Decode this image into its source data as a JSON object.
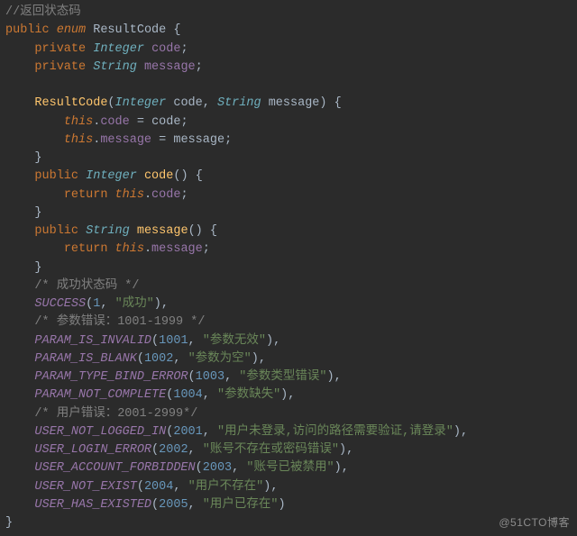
{
  "watermark": "@51CTO博客",
  "code": {
    "comment_top": "//返回状态码",
    "kw_public": "public",
    "kw_enum": "enum",
    "class_name": "ResultCode",
    "brace_open": "{",
    "kw_private": "private",
    "type_integer": "Integer",
    "type_string": "String",
    "field_code": "code",
    "field_message": "message",
    "semicolon": ";",
    "ctor_name": "ResultCode",
    "paren_open": "(",
    "paren_close": ")",
    "comma": ",",
    "space": " ",
    "kw_this": "this",
    "dot": ".",
    "eq": "=",
    "brace_close": "}",
    "method_code": "code",
    "method_message": "message",
    "kw_return": "return",
    "cmt_success": "/* 成功状态码 */",
    "enum_success": "SUCCESS",
    "num_1": "1",
    "str_success": "\"成功\"",
    "cmt_param": "/* 参数错误：1001-1999 */",
    "enum_pinv": "PARAM_IS_INVALID",
    "num_1001": "1001",
    "str_pinv": "\"参数无效\"",
    "enum_pblank": "PARAM_IS_BLANK",
    "num_1002": "1002",
    "str_pblank": "\"参数为空\"",
    "enum_ptype": "PARAM_TYPE_BIND_ERROR",
    "num_1003": "1003",
    "str_ptype": "\"参数类型错误\"",
    "enum_pnc": "PARAM_NOT_COMPLETE",
    "num_1004": "1004",
    "str_pnc": "\"参数缺失\"",
    "cmt_user": "/* 用户错误：2001-2999*/",
    "enum_unli": "USER_NOT_LOGGED_IN",
    "num_2001": "2001",
    "str_unli": "\"用户未登录,访问的路径需要验证,请登录\"",
    "enum_ule": "USER_LOGIN_ERROR",
    "num_2002": "2002",
    "str_ule": "\"账号不存在或密码错误\"",
    "enum_uaf": "USER_ACCOUNT_FORBIDDEN",
    "num_2003": "2003",
    "str_uaf": "\"账号已被禁用\"",
    "enum_une": "USER_NOT_EXIST",
    "num_2004": "2004",
    "str_une": "\"用户不存在\"",
    "enum_uhe": "USER_HAS_EXISTED",
    "num_2005": "2005",
    "str_uhe": "\"用户已存在\""
  }
}
